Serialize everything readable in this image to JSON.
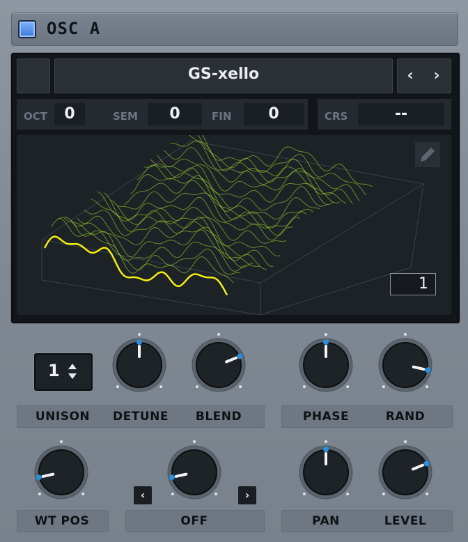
{
  "header": {
    "title": "OSC A"
  },
  "preset": {
    "name": "GS-xello",
    "prev_icon": "chevron-left-icon",
    "next_icon": "chevron-right-icon"
  },
  "tuning": [
    {
      "label": "OCT",
      "value": "0"
    },
    {
      "label": "SEM",
      "value": "0"
    },
    {
      "label": "FIN",
      "value": "0"
    },
    {
      "label": "CRS",
      "value": "--"
    }
  ],
  "wavetable": {
    "frame": "1",
    "edit_icon": "pencil-icon",
    "line_color": "#a6e22e",
    "active_color": "#f4ee10"
  },
  "unison": {
    "label": "UNISON",
    "value": "1"
  },
  "knobs": {
    "detune": {
      "label": "DETUNE",
      "value": 0.5
    },
    "blend": {
      "label": "BLEND",
      "value": 0.75
    },
    "phase": {
      "label": "PHASE",
      "value": 0.5
    },
    "rand": {
      "label": "RAND",
      "value": 0.88
    },
    "wt_pos": {
      "label": "WT POS",
      "value": 0.12
    },
    "filter": {
      "label": "OFF",
      "value": 0.12
    },
    "pan": {
      "label": "PAN",
      "value": 0.5
    },
    "level": {
      "label": "LEVEL",
      "value": 0.75
    }
  },
  "accent_color": "#2a8fdb"
}
